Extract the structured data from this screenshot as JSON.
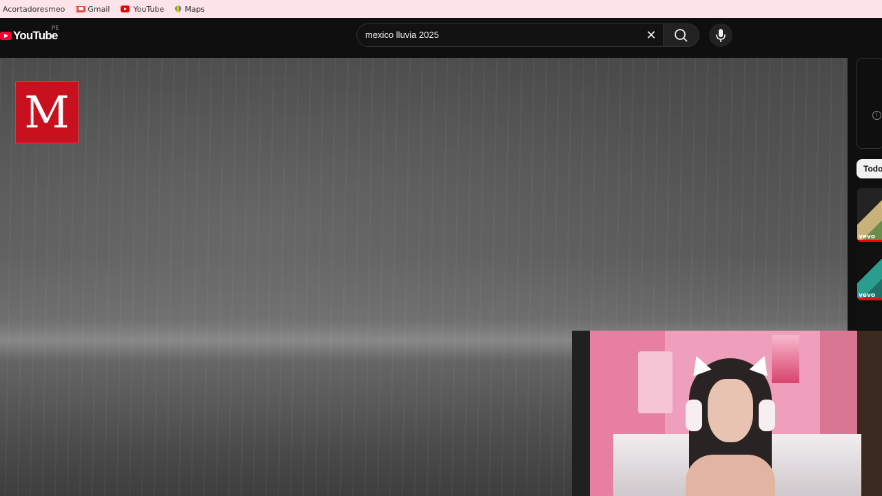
{
  "bookmarks": [
    {
      "label": "Acortadoresmeo",
      "icon": "none"
    },
    {
      "label": "Gmail",
      "icon": "gmail-icon"
    },
    {
      "label": "YouTube",
      "icon": "youtube-icon"
    },
    {
      "label": "Maps",
      "icon": "maps-icon"
    }
  ],
  "header": {
    "logo_text": "YouTube",
    "region": "PE",
    "search_value": "mexico lluvia 2025"
  },
  "video": {
    "channel_logo_text": "M"
  },
  "sidebar": {
    "chip_label": "Todo",
    "thumbs": [
      {
        "badge": "vevo"
      },
      {
        "badge": "vevo"
      }
    ]
  },
  "colors": {
    "bookmark_bar": "#fde3ea",
    "header_bg": "#0f0f0f",
    "brand_red": "#ff0033",
    "channel_logo": "#c8101e"
  }
}
